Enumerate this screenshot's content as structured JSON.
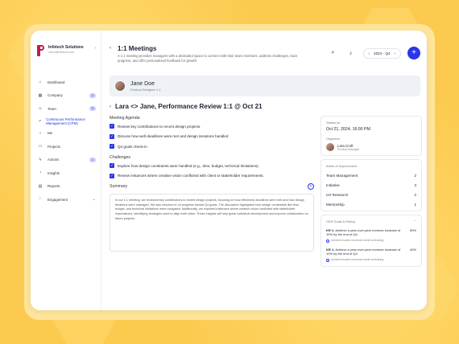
{
  "org": {
    "name": "Infotech Solutions",
    "email": "xxxxx@infotech.com"
  },
  "nav": [
    {
      "label": "Dashboard",
      "icon": "home-icon"
    },
    {
      "label": "Company",
      "icon": "building-icon",
      "badge": "3"
    },
    {
      "label": "Team",
      "icon": "team-icon",
      "badge": "5"
    },
    {
      "label": "Continuous Performance Management (CPM)",
      "icon": "trend-icon",
      "active": true
    },
    {
      "label": "Me",
      "icon": "user-icon"
    },
    {
      "label": "Projects",
      "icon": "folder-icon"
    },
    {
      "label": "Actions",
      "icon": "bolt-icon",
      "badge": "1"
    },
    {
      "label": "Insights",
      "icon": "chart-icon"
    },
    {
      "label": "Reports",
      "icon": "report-icon"
    },
    {
      "label": "Engagement",
      "icon": "heart-icon"
    }
  ],
  "header": {
    "title": "1:1 Meetings",
    "description": "A 1:1 meeting provides managers with a dedicated space to connect with their team members, address challenges, track progress, and offer personalized feedback for growth.",
    "period": "2024 - Q4"
  },
  "employee": {
    "name": "Jane Doe",
    "role": "Product Designer 1.1"
  },
  "review": {
    "title": "Lara <> Jane, Performance Review 1:1 @ Oct 21"
  },
  "agenda": {
    "heading": "Meeting Agenda",
    "items": [
      "Review key contributions to recent design projects.",
      "Discuss how well deadlines were met and design iterations handled",
      "Q4 goals check-in"
    ]
  },
  "challenges": {
    "heading": "Challenges",
    "items": [
      "Explore how design constraints were handled (e.g., time, budget, technical limitations).",
      "Review instances where creative vision conflicted with client or stakeholder requirements."
    ]
  },
  "summary": {
    "heading": "Summary",
    "text": "In our 1:1 meeting, we reviewed key contributions to recent design projects, focusing on how effectively deadlines were met and how design iterations were managed. We also checked in on progress toward Q4 goals. The discussion highlighted how design constraints like time, budget, and technical limitations were navigated. Additionally, we explored instances where creative vision conflicted with stakeholder expectations, identifying strategies used to align both sides. These insights will help guide individual development and improve collaboration on future projects."
  },
  "meta": {
    "started_label": "Started at",
    "started_value": "Oct 21, 2024, 16:00 PM",
    "organizer_label": "Organizer",
    "organizer_name": "Lara Croft",
    "organizer_role": "Product Manager"
  },
  "areas": {
    "heading": "Areas of Improvement",
    "items": [
      {
        "name": "Team Management",
        "count": "2"
      },
      {
        "name": "Initiative",
        "count": "3"
      },
      {
        "name": "UX Research",
        "count": "2"
      },
      {
        "name": "Mentorship",
        "count": "1"
      }
    ]
  },
  "okr": {
    "heading": "OKR Goals & Rating",
    "items": [
      {
        "code": "KR 1:",
        "text": "Achieve a year-over-year revenue increase of 10% by the end of Q4.",
        "pct": "60%",
        "sub": "Achieve trusted revenues while increasing"
      },
      {
        "code": "KR 1:",
        "text": "Achieve a year-over-year revenue increase of 10% by the end of Q4.",
        "pct": "40%",
        "sub": "Achieve trusted revenues while increasing"
      }
    ]
  },
  "colors": {
    "accent": "#2a36e8",
    "brand": "#c2185b",
    "background": "#fbca4e"
  }
}
